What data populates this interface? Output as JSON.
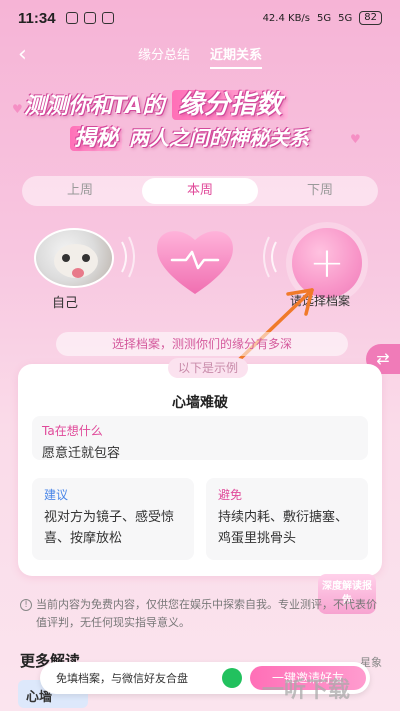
{
  "status_bar": {
    "time": "11:34",
    "speed": "42.4 KB/s",
    "network": "5G",
    "network2": "5G",
    "battery": "82"
  },
  "nav": {
    "tabs": [
      {
        "label": "缘分总结"
      },
      {
        "label": "近期关系"
      }
    ]
  },
  "headline": {
    "line1_prefix": "测测你和TA的",
    "line1_accent": "缘分指数",
    "line2_accent": "揭秘",
    "line2_suffix": "两人之间的神秘关系"
  },
  "week_tabs": [
    {
      "label": "上周"
    },
    {
      "label": "本周"
    },
    {
      "label": "下周"
    }
  ],
  "profiles": {
    "self_label": "自己",
    "add_label": "请选择档案"
  },
  "hint": "选择档案，测测你们的缘分有多深",
  "card": {
    "example_tag": "以下是示例",
    "title": "心墙难破",
    "think_title": "Ta在想什么",
    "think_body": "愿意迁就包容",
    "suggest_title": "建议",
    "suggest_body": "视对方为镜子、感受惊喜、按摩放松",
    "avoid_title": "避免",
    "avoid_body": "持续内耗、敷衍搪塞、鸡蛋里挑骨头"
  },
  "deep_report": "深度解读报告",
  "disclaimer": "当前内容为免费内容，仅供您在娱乐中探索自我。专业测评，不代表价值评判，无任何现实指导意义。",
  "more": {
    "title": "更多解读",
    "right": "星象",
    "chip": "心墙"
  },
  "bottom_bar": {
    "text": "免填档案，与微信好友合盘",
    "invite": "一键邀请好友"
  },
  "watermark": "一听下载",
  "colors": {
    "accent": "#e04a9a",
    "suggest": "#4a86e8",
    "wechat": "#22c15e"
  }
}
